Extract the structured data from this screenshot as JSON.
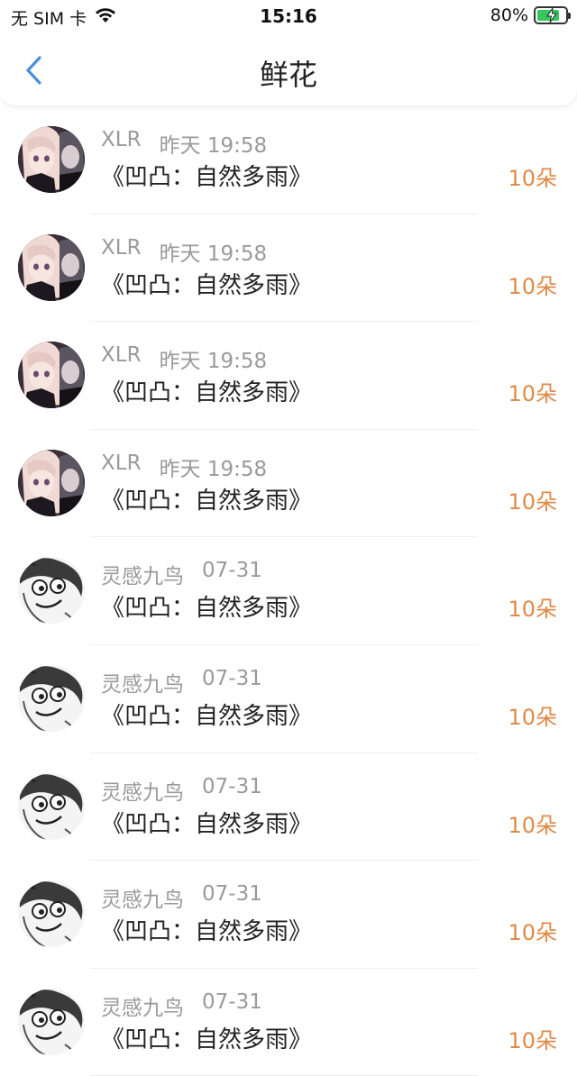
{
  "status_bar": {
    "carrier": "无 SIM 卡",
    "time": "15:16",
    "battery_percent": "80%",
    "battery_level": 0.8,
    "wifi_icon": "wifi-icon",
    "battery_icon": "battery-charging-icon"
  },
  "nav": {
    "title": "鲜花",
    "back_icon": "chevron-left-icon"
  },
  "colors": {
    "accent": "#4a90d9",
    "amount": "#e08a48",
    "meta": "#9a9a9a",
    "title": "#222222"
  },
  "records": [
    {
      "user": "XLR",
      "time": "昨天 19:58",
      "work": "《凹凸：自然多雨》",
      "amount": "10朵",
      "avatar": "anime-avatar"
    },
    {
      "user": "XLR",
      "time": "昨天 19:58",
      "work": "《凹凸：自然多雨》",
      "amount": "10朵",
      "avatar": "anime-avatar"
    },
    {
      "user": "XLR",
      "time": "昨天 19:58",
      "work": "《凹凸：自然多雨》",
      "amount": "10朵",
      "avatar": "anime-avatar"
    },
    {
      "user": "XLR",
      "time": "昨天 19:58",
      "work": "《凹凸：自然多雨》",
      "amount": "10朵",
      "avatar": "anime-avatar"
    },
    {
      "user": "灵感九鸟",
      "time": "07-31",
      "work": "《凹凸：自然多雨》",
      "amount": "10朵",
      "avatar": "meme-face-avatar"
    },
    {
      "user": "灵感九鸟",
      "time": "07-31",
      "work": "《凹凸：自然多雨》",
      "amount": "10朵",
      "avatar": "meme-face-avatar"
    },
    {
      "user": "灵感九鸟",
      "time": "07-31",
      "work": "《凹凸：自然多雨》",
      "amount": "10朵",
      "avatar": "meme-face-avatar"
    },
    {
      "user": "灵感九鸟",
      "time": "07-31",
      "work": "《凹凸：自然多雨》",
      "amount": "10朵",
      "avatar": "meme-face-avatar"
    },
    {
      "user": "灵感九鸟",
      "time": "07-31",
      "work": "《凹凸：自然多雨》",
      "amount": "10朵",
      "avatar": "meme-face-avatar"
    }
  ]
}
